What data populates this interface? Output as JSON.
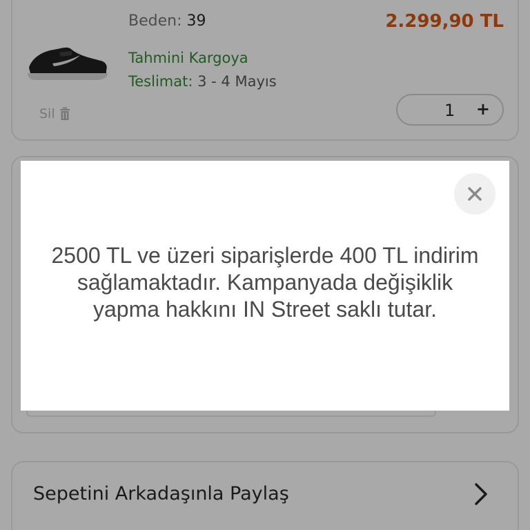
{
  "cart_item": {
    "size_label": "Beden:",
    "size_value": "39",
    "price": "2.299,90 TL",
    "delivery_line1": "Tahmini Kargoya",
    "delivery_label": "Teslimat:",
    "delivery_dates": "3 - 4 Mayıs",
    "delete_label": "Sil",
    "quantity": "1",
    "increment_symbol": "+"
  },
  "share": {
    "label": "Sepetini Arkadaşınla Paylaş",
    "chevron_icon": "chevron-right-icon"
  },
  "modal": {
    "close_icon": "close-icon",
    "message": "2500 TL ve üzeri siparişlerde 400 TL indirim sağlamaktadır. Kampanyada değişiklik yapma hakkını IN Street saklı tutar."
  },
  "colors": {
    "price": "#8b3a0e",
    "delivery": "#235a23",
    "overlay": "#a9a9a9",
    "modal_bg": "#ffffff"
  }
}
